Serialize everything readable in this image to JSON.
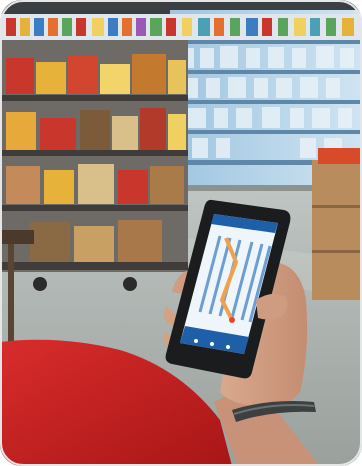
{
  "photo": {
    "phone_app": {
      "header_text": "",
      "footer_text": ""
    }
  }
}
